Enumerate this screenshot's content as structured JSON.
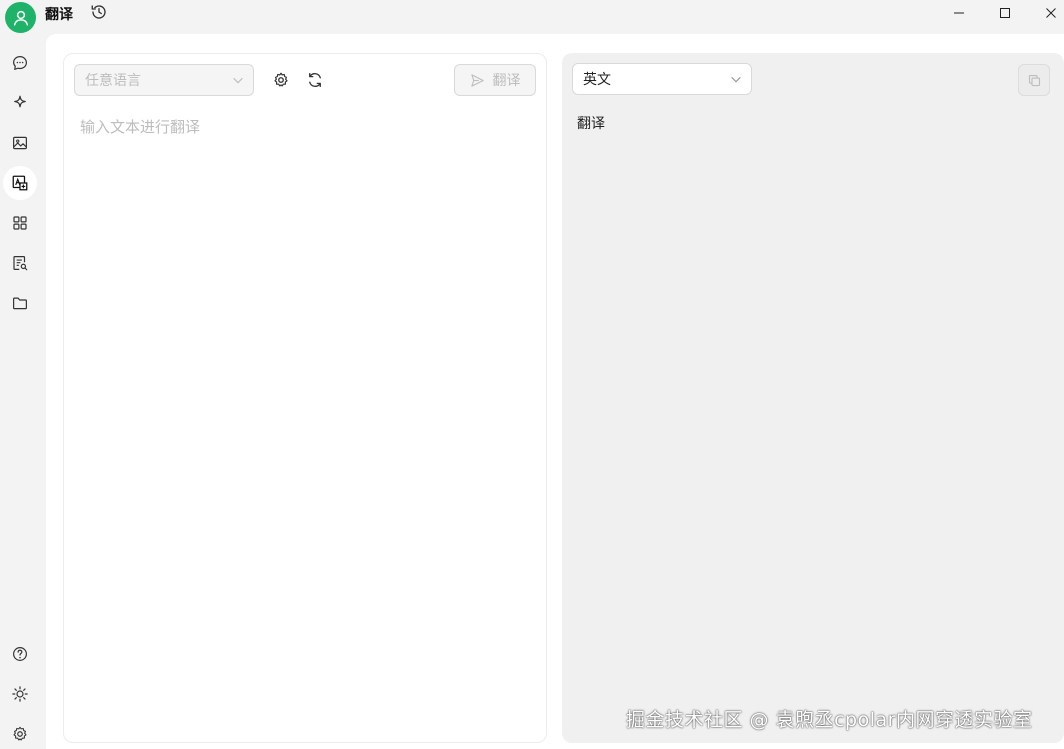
{
  "app": {
    "title": "翻译"
  },
  "titlebar": {
    "history_icon": "history-icon",
    "window_controls": [
      "minimize-icon",
      "maximize-icon",
      "close-icon"
    ]
  },
  "sidebar": {
    "items": [
      {
        "name": "chat",
        "icon": "chat-bubble-icon",
        "active": false
      },
      {
        "name": "agents",
        "icon": "sparkle-icon",
        "active": false
      },
      {
        "name": "paintings",
        "icon": "image-icon",
        "active": false
      },
      {
        "name": "translate",
        "icon": "translate-icon",
        "active": true
      },
      {
        "name": "apps",
        "icon": "grid-icon",
        "active": false
      },
      {
        "name": "knowledge",
        "icon": "document-search-icon",
        "active": false
      },
      {
        "name": "files",
        "icon": "folder-icon",
        "active": false
      }
    ],
    "bottom_items": [
      {
        "name": "help",
        "icon": "help-icon"
      },
      {
        "name": "theme",
        "icon": "sun-icon"
      },
      {
        "name": "settings",
        "icon": "gear-icon"
      }
    ]
  },
  "source": {
    "language_placeholder": "任意语言",
    "translate_button": "翻译",
    "input_placeholder": "输入文本进行翻译",
    "input_value": ""
  },
  "target": {
    "language": "英文",
    "result": "翻译"
  },
  "watermark": "掘金技术社区 @ 袁煦丞cpolar内网穿透实验室",
  "colors": {
    "accent": "#1fb36a",
    "sidebar_bg": "#f3f3f3",
    "result_panel_bg": "#f0f0f0"
  }
}
